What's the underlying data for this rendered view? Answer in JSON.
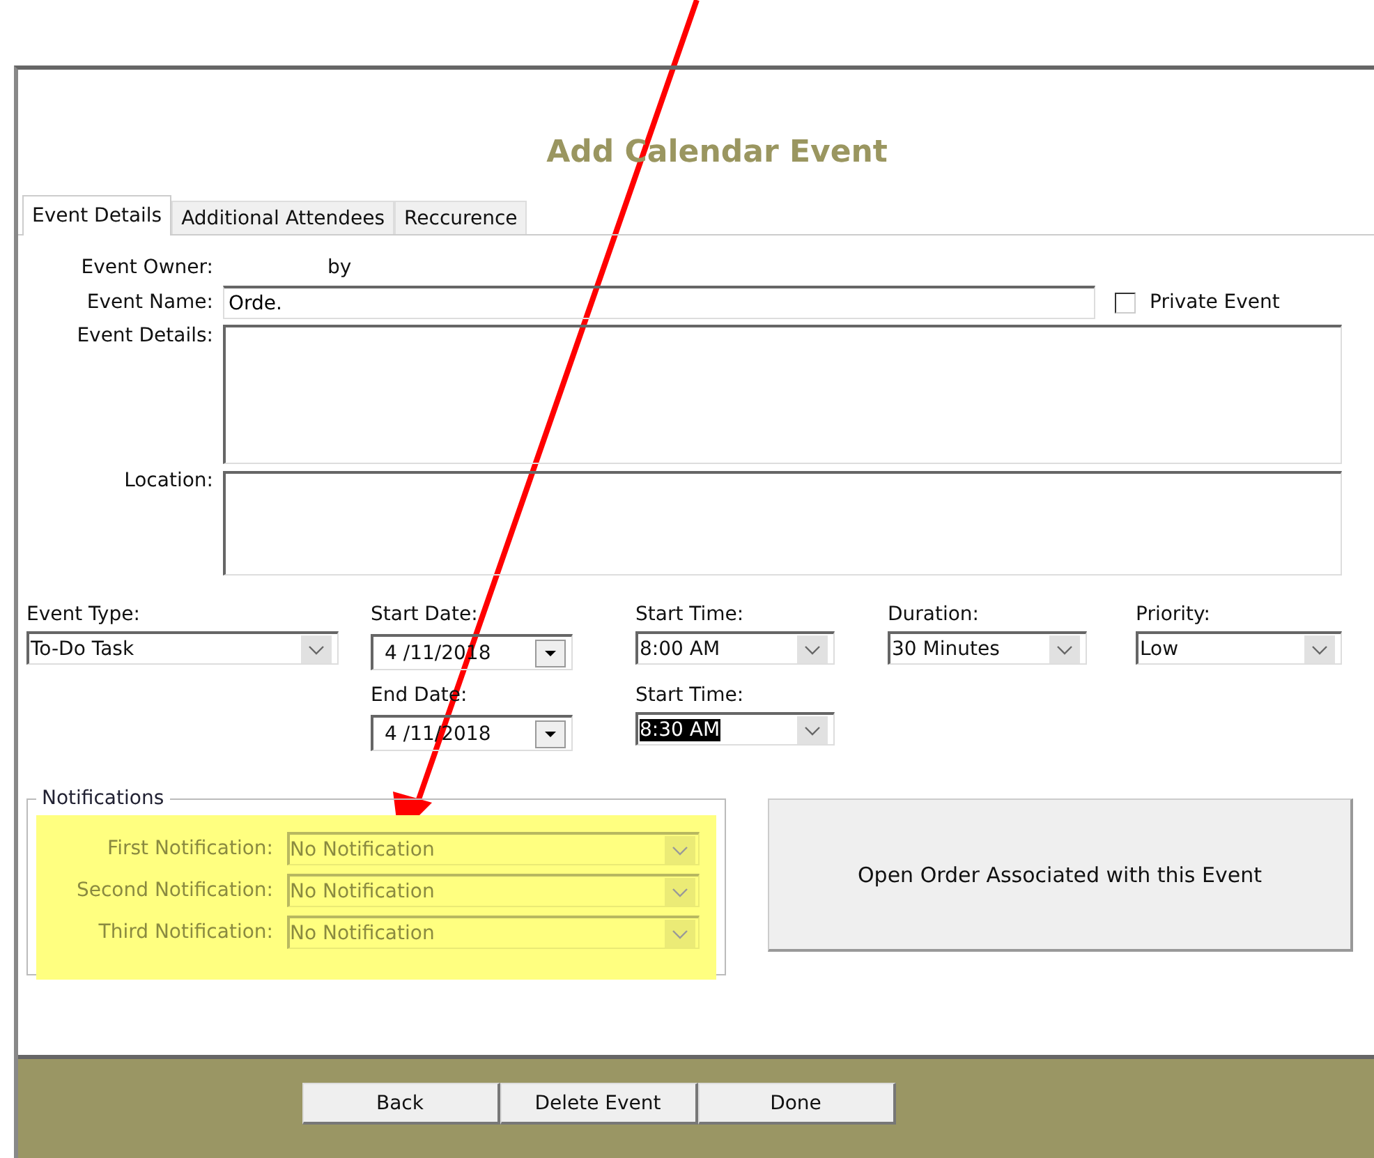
{
  "window": {
    "title": "Add Calendar Event"
  },
  "tabs": [
    {
      "label": "Event Details",
      "selected": true
    },
    {
      "label": "Additional Attendees",
      "selected": false
    },
    {
      "label": "Reccurence",
      "selected": false
    }
  ],
  "owner": {
    "label": "Event Owner:",
    "value": "by"
  },
  "event_name": {
    "label": "Event Name:",
    "value": "Orde."
  },
  "private_event": {
    "label": "Private Event",
    "checked": false
  },
  "event_details": {
    "label": "Event Details:"
  },
  "location": {
    "label": "Location:"
  },
  "schedule_rows": [
    [
      {
        "label": "Event Type:",
        "value": "To-Do Task",
        "kind": "combo",
        "text_selected": false
      },
      {
        "label": "Start Date:",
        "value": "4 /11/2018",
        "kind": "date",
        "text_selected": false
      },
      {
        "label": "Start Time:",
        "value": "8:00 AM",
        "kind": "combo",
        "text_selected": false
      },
      {
        "label": "Duration:",
        "value": "30 Minutes",
        "kind": "combo",
        "text_selected": false
      },
      {
        "label": "Priority:",
        "value": "Low",
        "kind": "combo",
        "text_selected": false
      }
    ],
    [
      {
        "kind": "empty"
      },
      {
        "label": "End Date:",
        "value": "4 /11/2018",
        "kind": "date",
        "text_selected": false
      },
      {
        "label": "Start Time:",
        "value": "8:30 AM",
        "kind": "combo",
        "text_selected": true
      }
    ]
  ],
  "notifications": {
    "title": "Notifications",
    "highlighted": true,
    "disabled": true,
    "rows": [
      {
        "label": "First Notification:",
        "value": "No Notification"
      },
      {
        "label": "Second Notification:",
        "value": "No Notification"
      },
      {
        "label": "Third Notification:",
        "value": "No Notification"
      }
    ]
  },
  "open_order_button": "Open Order Associated with this Event",
  "buttons": [
    "Back",
    "Delete Event",
    "Done"
  ]
}
